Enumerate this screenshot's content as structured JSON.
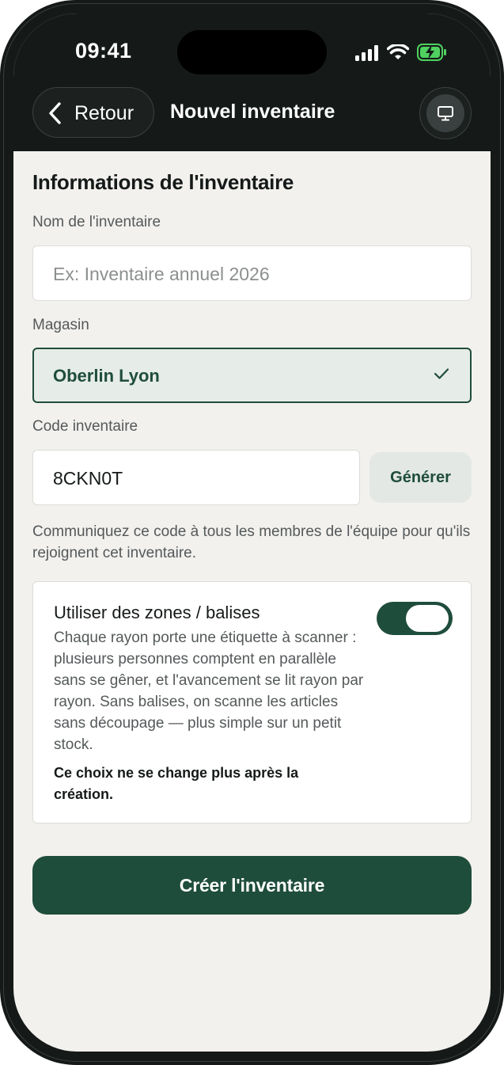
{
  "status_bar": {
    "time": "09:41",
    "icons": [
      "cellular-signal-icon",
      "wifi-icon",
      "battery-charging-icon"
    ]
  },
  "nav": {
    "back_label": "Retour",
    "title": "Nouvel inventaire",
    "right_icon": "monitor-icon"
  },
  "form": {
    "section_title": "Informations de l'inventaire",
    "name": {
      "label": "Nom de l'inventaire",
      "value": "",
      "placeholder": "Ex: Inventaire annuel 2026"
    },
    "store": {
      "label": "Magasin",
      "value": "Oberlin Lyon",
      "selected": true
    },
    "code": {
      "label": "Code inventaire",
      "value": "8CKN0T",
      "generate_label": "Générer",
      "helper": "Communiquez ce code à tous les membres de l'équipe pour qu'ils rejoignent cet inventaire."
    },
    "zones": {
      "title": "Utiliser des zones / balises",
      "description": "Chaque rayon porte une étiquette à scanner : plusieurs personnes comptent en parallèle sans se gêner, et l'avancement se lit rayon par rayon. Sans balises, on scanne les articles sans découpage — plus simple sur un petit stock.",
      "note": "Ce choix ne se change plus après la création.",
      "enabled": true
    },
    "submit_label": "Créer l'inventaire"
  },
  "colors": {
    "brand_green": "#1f4d3c",
    "header_dark": "#151a19",
    "background": "#f2f1ee",
    "placeholder": "#8c8f8f"
  }
}
